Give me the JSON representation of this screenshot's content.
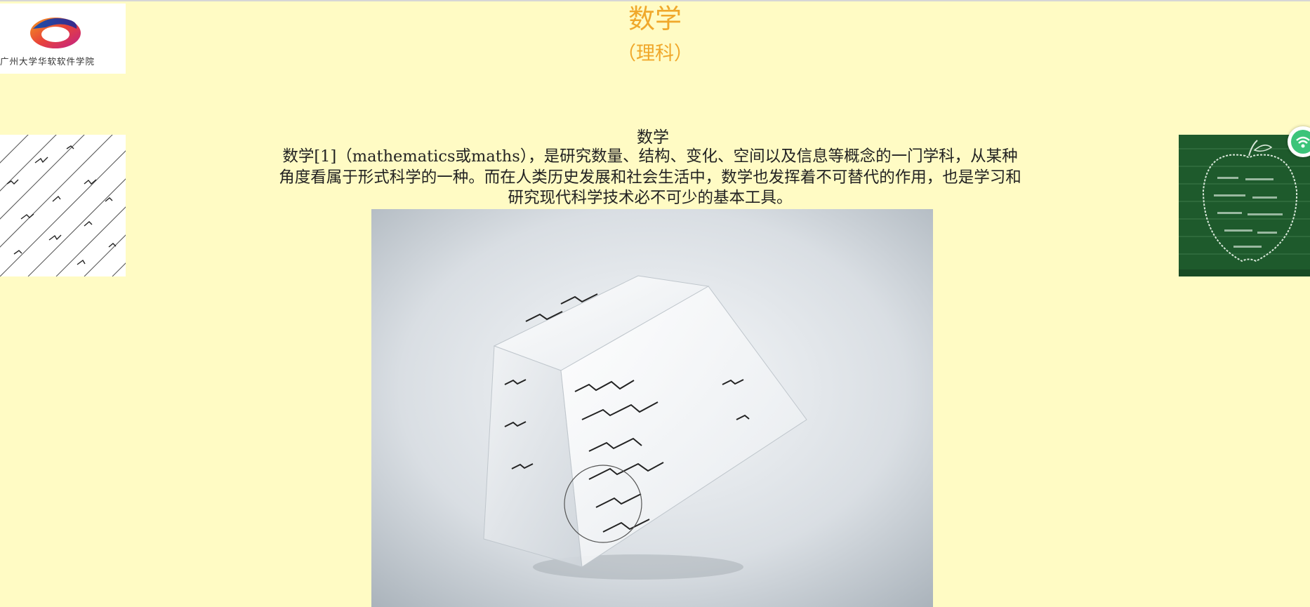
{
  "logo": {
    "text": "广州大学华软软件学院",
    "icon": "university-logo-ring"
  },
  "header": {
    "title": "数学",
    "subtitle": "（理科）"
  },
  "content": {
    "heading": "数学",
    "paragraph": "数学[1]（mathematics或maths），是研究数量、结构、变化、空间以及信息等概念的一门学科，从某种角度看属于形式科学的一种。而在人类历史发展和社会生活中，数学也发挥着不可替代的作用，也是学习和研究现代科学技术必不可少的基本工具。"
  },
  "images": {
    "left_side": "formula-paper-image",
    "right_side": "chalkboard-apple-image",
    "main": "math-formula-cube-image"
  },
  "colors": {
    "page_background": "#fffbc4",
    "title": "#f0a82b",
    "body_text": "#222222",
    "chalkboard": "#1e5a2c"
  }
}
